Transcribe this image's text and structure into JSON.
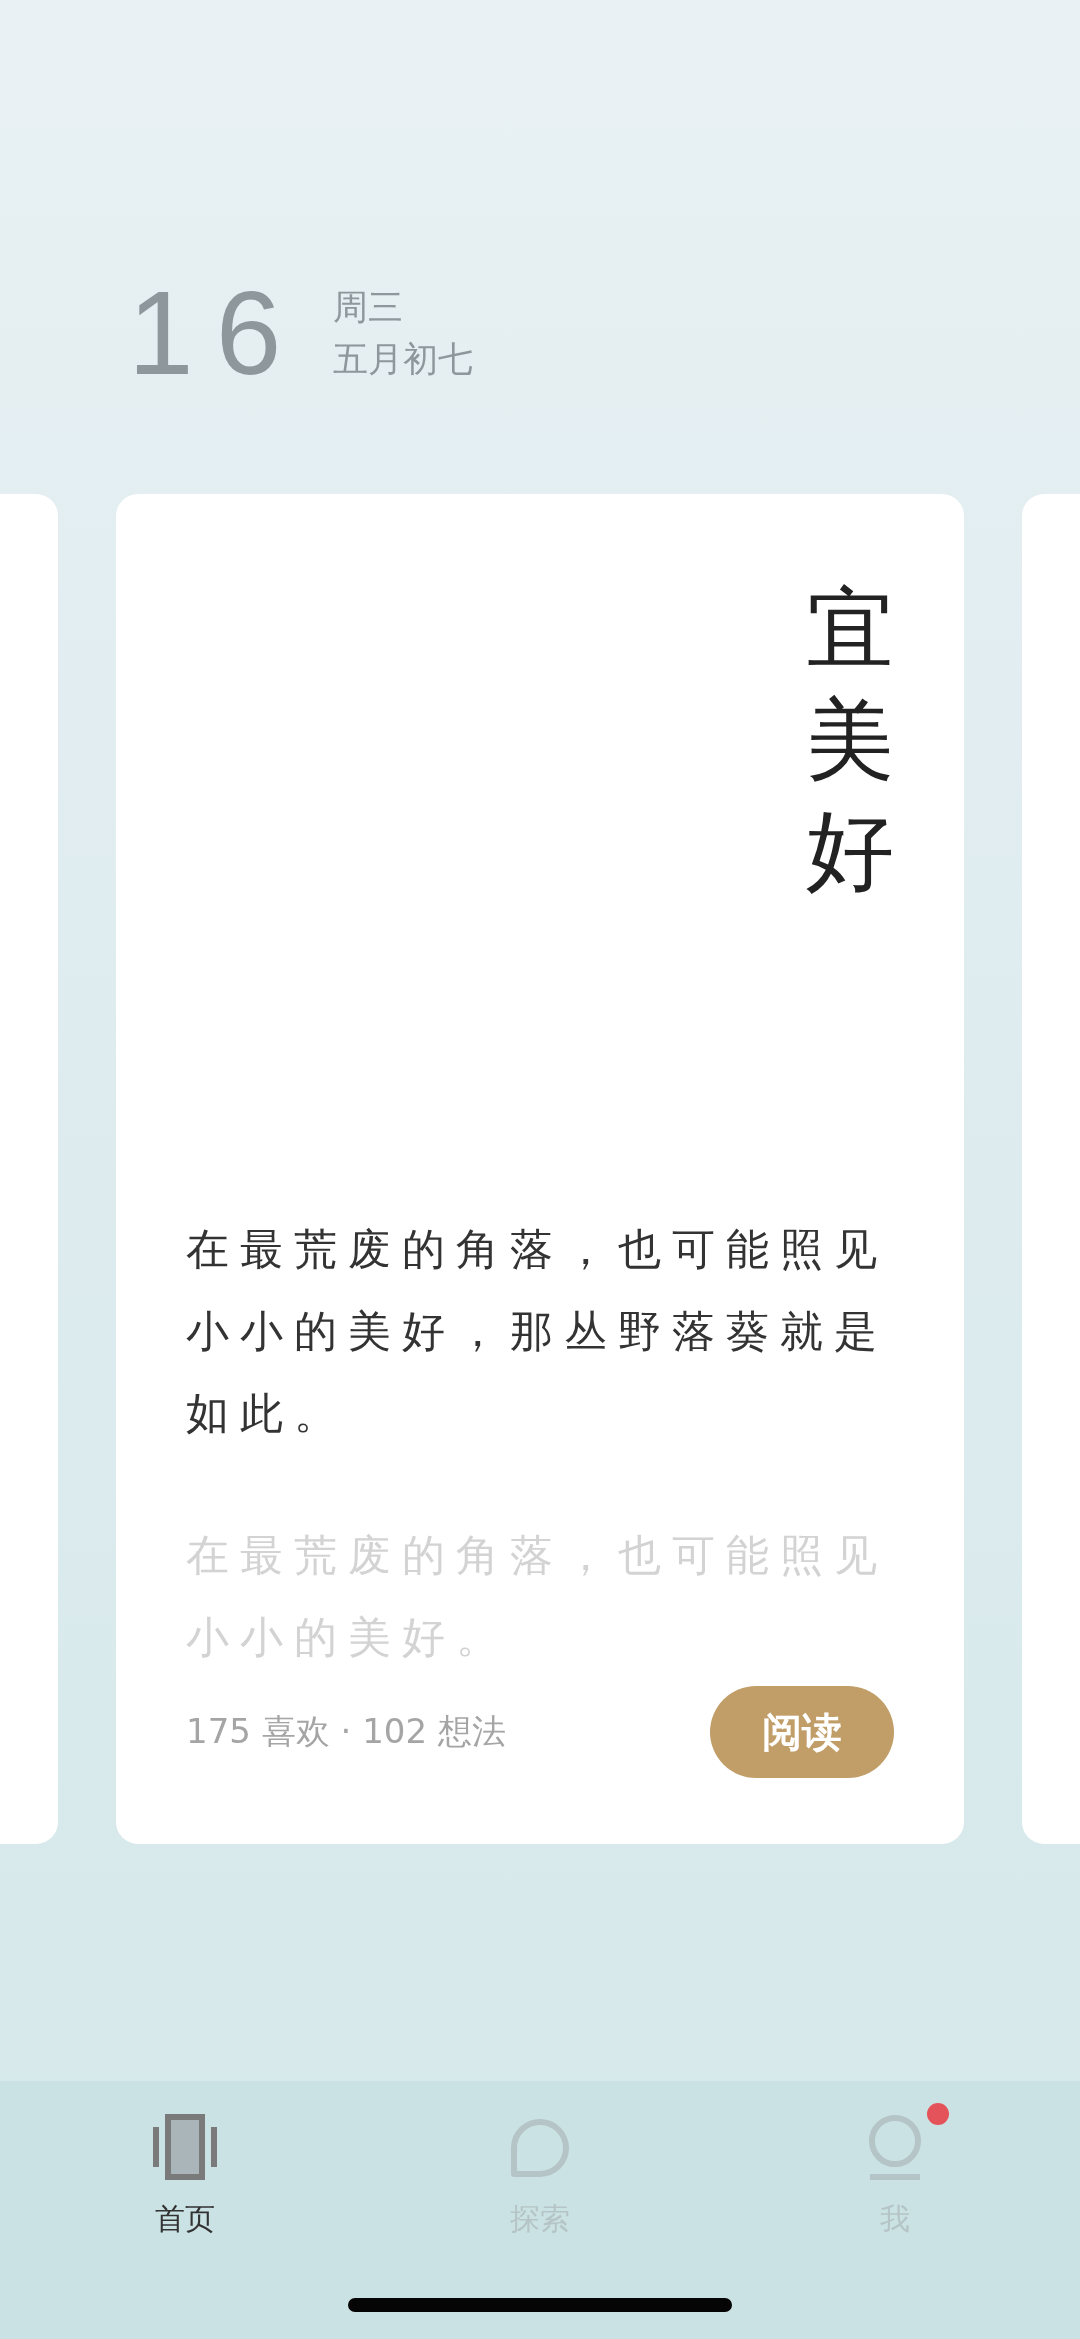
{
  "date": {
    "day": "16",
    "weekday": "周三",
    "lunar": "五月初七"
  },
  "card": {
    "title": "宜美好",
    "quote": "在最荒废的角落，也可能照见小小的美好，那丛野落葵就是如此。",
    "excerpt": "在最荒废的角落，也可能照见小小的美好。",
    "stats": "175 喜欢 · 102 想法",
    "button": "阅读"
  },
  "tabs": [
    {
      "label": "首页",
      "kind": "home",
      "selected": true,
      "dot": false
    },
    {
      "label": "探索",
      "kind": "explore",
      "selected": false,
      "dot": false
    },
    {
      "label": "我",
      "kind": "me",
      "selected": false,
      "dot": true
    }
  ]
}
